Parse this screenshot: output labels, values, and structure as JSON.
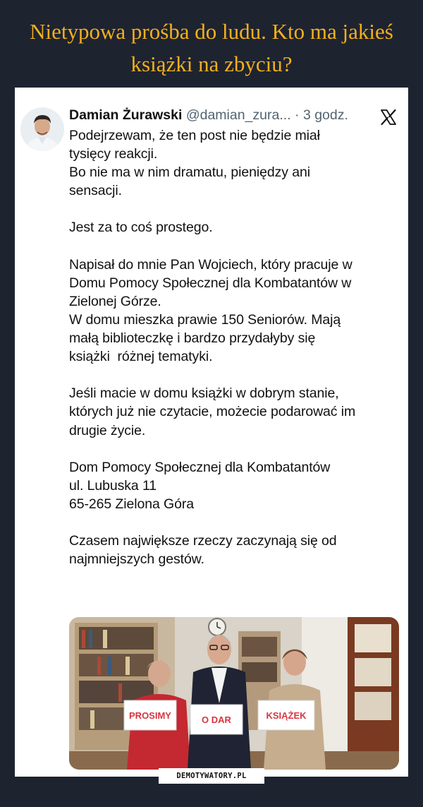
{
  "page": {
    "title": "Nietypowa prośba do ludu. Kto ma jakieś książki na zbyciu?",
    "watermark": "DEMOTYWATORY.PL"
  },
  "tweet": {
    "author_name": "Damian Żurawski",
    "handle": "@damian_zura...",
    "separator": "·",
    "time": "3 godz.",
    "platform_icon": "x-logo-icon",
    "body_lines": [
      "Podejrzewam, że ten post nie będzie miał",
      "tysięcy reakcji.",
      "Bo nie ma w nim dramatu, pieniędzy ani",
      "sensacji.",
      "",
      "Jest za to coś prostego.",
      "",
      "Napisał do mnie Pan Wojciech, który pracuje w",
      "Domu Pomocy Społecznej dla Kombatantów w",
      "Zielonej Górze.",
      "W domu mieszka prawie 150 Seniorów. Mają",
      "małą biblioteczkę i bardzo przydałyby się",
      "książki  różnej tematyki.",
      "",
      "Jeśli macie w domu książki w dobrym stanie,",
      "których już nie czytacie, możecie podarować im",
      "drugie życie.",
      "",
      "Dom Pomocy Społecznej dla Kombatantów",
      "ul. Lubuska 11",
      "65-265 Zielona Góra",
      "",
      "Czasem największe rzeczy zaczynają się od",
      "najmniejszych gestów."
    ]
  },
  "photo": {
    "sign_1": "PROSIMY",
    "sign_2": "O DAR",
    "sign_3": "KSIĄŻEK"
  }
}
